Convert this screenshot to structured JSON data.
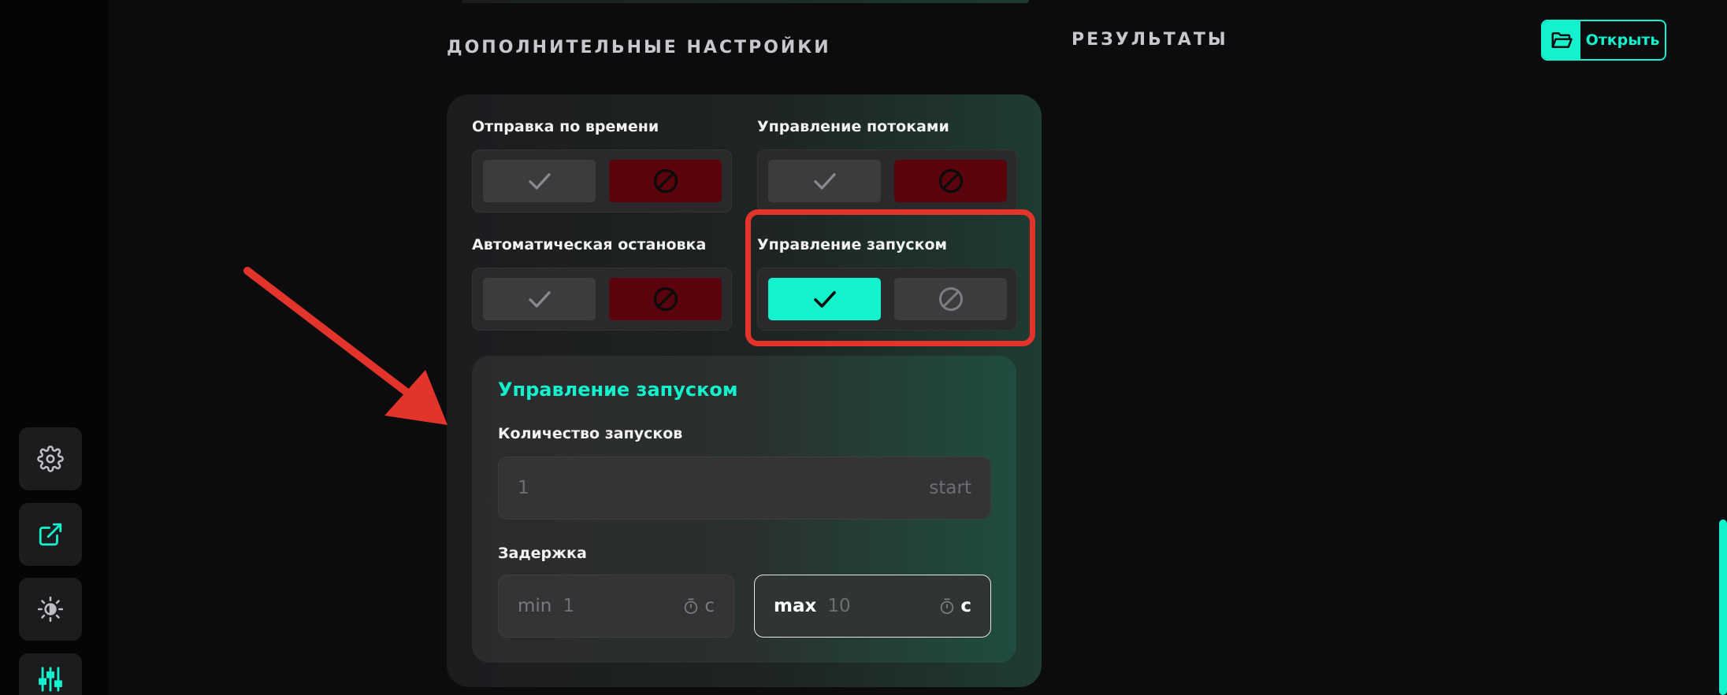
{
  "sidebar": {
    "buttons": [
      {
        "icon": "gear-icon"
      },
      {
        "icon": "external-link-icon",
        "accent": true
      },
      {
        "icon": "theme-icon"
      },
      {
        "icon": "sliders-icon",
        "accent": true
      }
    ]
  },
  "section_title": "ДОПОЛНИТЕЛЬНЫЕ НАСТРОЙКИ",
  "results": {
    "title": "РЕЗУЛЬТАТЫ",
    "open_label": "Открыть"
  },
  "options": [
    {
      "label": "Отправка по времени",
      "state": "off"
    },
    {
      "label": "Управление потоками",
      "state": "off"
    },
    {
      "label": "Автоматическая остановка",
      "state": "off"
    },
    {
      "label": "Управление запуском",
      "state": "on"
    }
  ],
  "launch_control": {
    "title": "Управление запуском",
    "count_label": "Количество запусков",
    "count_value": "1",
    "count_suffix": "start",
    "delay_label": "Задержка",
    "delay_min_prefix": "min",
    "delay_min_value": "1",
    "delay_max_prefix": "max",
    "delay_max_value": "10",
    "unit": "с"
  },
  "colors": {
    "accent": "#13f2cd",
    "disabled_red": "#5a030c",
    "highlight_red": "#e3342c"
  }
}
